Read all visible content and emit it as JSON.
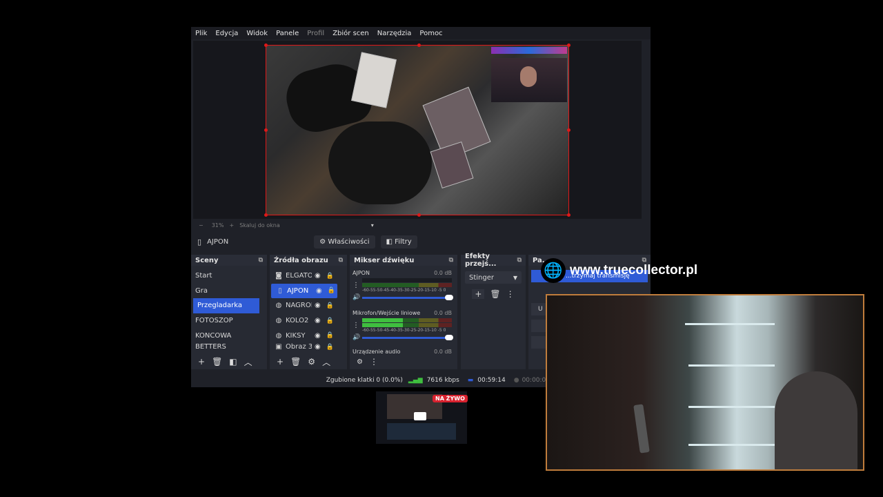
{
  "menu": [
    "Plik",
    "Edycja",
    "Widok",
    "Panele",
    "Profil",
    "Zbiór scen",
    "Narzędzia",
    "Pomoc"
  ],
  "zoom": {
    "minus": "−",
    "value": "31%",
    "plus": "+",
    "scale": "Skaluj do okna",
    "caret": "▾"
  },
  "context": {
    "source_name": "AJPON",
    "properties": "Właściwości",
    "filters": "Filtry"
  },
  "scenes": {
    "title": "Sceny",
    "items": [
      "Start",
      "Gra",
      "Przegladarka",
      "FOTOSZOP",
      "KONCOWA",
      "BETTERS"
    ],
    "selected_index": 2
  },
  "sources": {
    "title": "Źródła obrazu",
    "items": [
      {
        "icon": "camera",
        "name": "ELGATO"
      },
      {
        "icon": "page",
        "name": "AJPON"
      },
      {
        "icon": "globe",
        "name": "NAGROI"
      },
      {
        "icon": "globe",
        "name": "KOLO2"
      },
      {
        "icon": "globe",
        "name": "KIKSY"
      },
      {
        "icon": "image",
        "name": "Obraz 3"
      }
    ],
    "selected_index": 1
  },
  "mixer": {
    "title": "Mikser dźwięku",
    "scale": "-60-55-50-45-40-35-30-25-20-15-10 -5 0",
    "channels": [
      {
        "name": "AJPON",
        "db": "0.0 dB",
        "level": 0.0,
        "volume": 1.0
      },
      {
        "name": "Mikrofon/Wejście liniowe",
        "db": "0.0 dB",
        "level": 0.45,
        "volume": 1.0
      },
      {
        "name": "Urządzenie audio",
        "db": "0.0 dB",
        "level": 0.0,
        "volume": 1.0
      }
    ]
  },
  "transitions": {
    "title": "Efekty przejś...",
    "selected": "Stinger"
  },
  "controls": {
    "title": "Pa...",
    "stop_stream": "...trzymaj transmisję",
    "u": "U"
  },
  "status": {
    "dropped": "Zgubione klatki 0 (0.0%)",
    "bitrate": "7616 kbps",
    "live_time": "00:59:14",
    "rec_time": "00:00:00"
  },
  "watermark": "www.truecollector.pl",
  "live_badge": "NA ŻYWO",
  "colors": {
    "accent": "#2f5bd6",
    "border_red": "#e01818",
    "live": "#d8222f",
    "webcam_border": "#c07d3c"
  }
}
